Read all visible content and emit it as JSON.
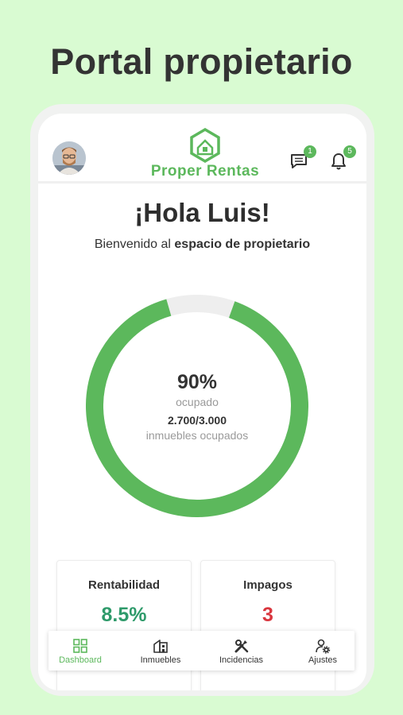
{
  "promo": {
    "title": "Portal propietario"
  },
  "header": {
    "logo_text": "Proper Rentas",
    "messages_count": "1",
    "notifications_count": "5",
    "icons": {
      "avatar": "user-avatar",
      "messages": "chat-icon",
      "notifications": "bell-icon",
      "logo": "house-hexagon-logo"
    }
  },
  "greeting": {
    "title": "¡Hola Luis!",
    "subtitle_prefix": "Bienvenido al ",
    "subtitle_bold": "espacio de propietario"
  },
  "occupancy": {
    "percent_text": "90%",
    "percent_label": "ocupado",
    "ratio_text": "2.700/3.000",
    "ratio_label": "inmuebles ocupados",
    "fraction": 0.9
  },
  "cards": [
    {
      "title": "Rentabilidad",
      "value": "8.5%",
      "color": "#2e9a6a"
    },
    {
      "title": "Impagos",
      "value": "3",
      "color": "#d9363e"
    }
  ],
  "bottom_nav": [
    {
      "label": "Dashboard",
      "icon": "grid-icon",
      "active": true
    },
    {
      "label": "Inmuebles",
      "icon": "building-icon",
      "active": false
    },
    {
      "label": "Incidencias",
      "icon": "tools-icon",
      "active": false
    },
    {
      "label": "Ajustes",
      "icon": "user-settings-icon",
      "active": false
    }
  ],
  "colors": {
    "accent": "#5cb85c",
    "background": "#d9fbd2",
    "donut_remainder": "#eeeeee"
  }
}
